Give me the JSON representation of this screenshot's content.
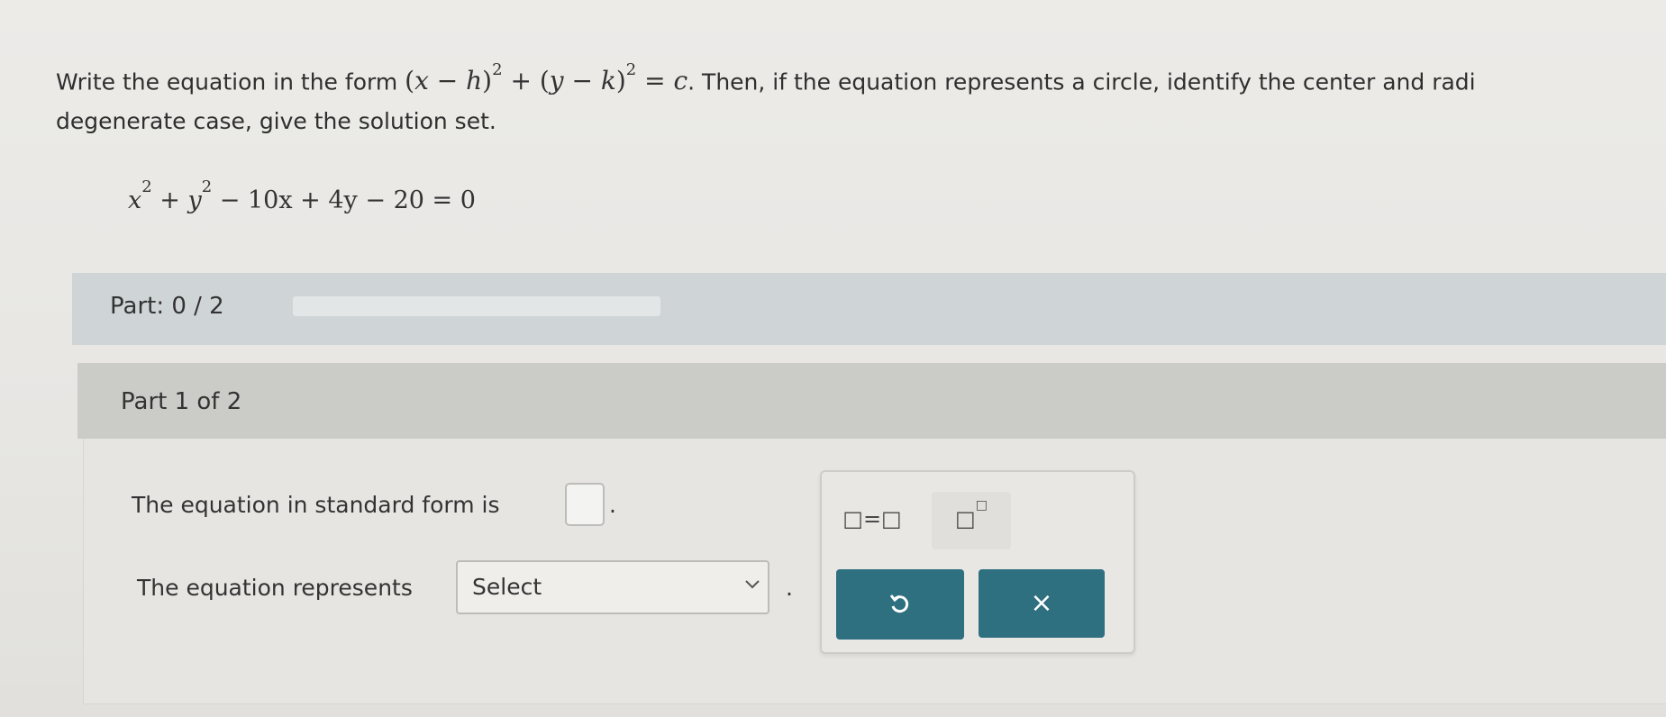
{
  "question": {
    "line1_before": "Write the equation in the form ",
    "line1_after": ". Then, if the equation represents a circle, identify the center and radi",
    "line2": "degenerate case, give the solution set.",
    "form": {
      "x": "x",
      "h": "h",
      "y": "y",
      "k": "k",
      "exp": "2",
      "c": "c"
    }
  },
  "given_equation": {
    "x": "x",
    "exp": "2",
    "y": "y",
    "rest": " − 10x + 4y − 20 = 0"
  },
  "progress": {
    "label": "Part: 0 / 2",
    "completed": 0,
    "total": 2
  },
  "part": {
    "header": "Part 1 of 2",
    "standard_form_prompt": "The equation in standard form is",
    "period": ".",
    "represents_prompt": "The equation represents",
    "select_value": "Select"
  },
  "math_toolbar": {
    "equals_tool": "□=□",
    "power_tool": "□",
    "undo_icon": "undo-icon",
    "clear_icon": "clear-icon",
    "clear_glyph": "×",
    "accent_color": "#2e6f80"
  }
}
